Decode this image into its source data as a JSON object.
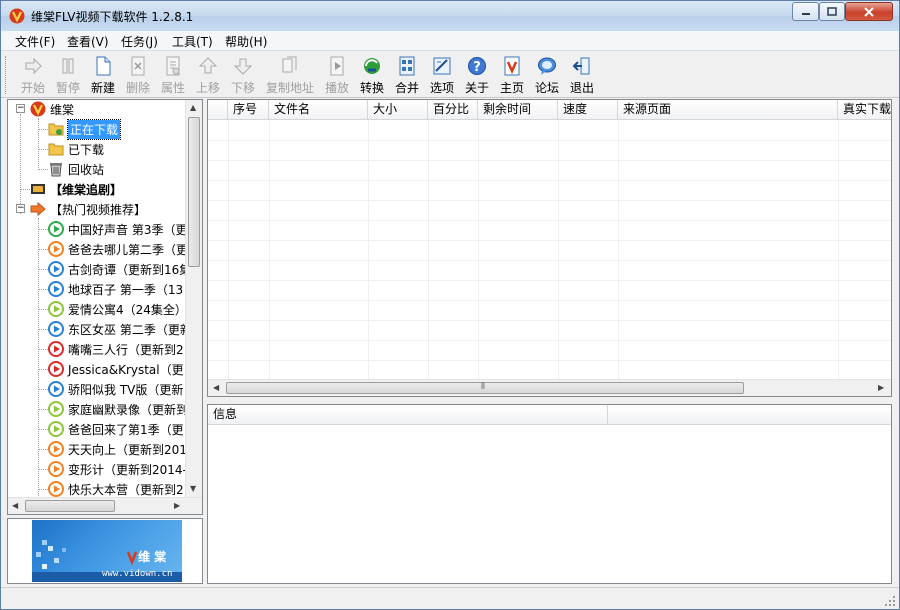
{
  "window": {
    "title": "维棠FLV视频下载软件 1.2.8.1"
  },
  "menu": [
    {
      "label": "文件(F)"
    },
    {
      "label": "查看(V)"
    },
    {
      "label": "任务(J)"
    },
    {
      "label": "工具(T)"
    },
    {
      "label": "帮助(H)"
    }
  ],
  "toolbar": [
    {
      "label": "开始",
      "icon": "start-arrow-icon",
      "enabled": false
    },
    {
      "label": "暂停",
      "icon": "pause-icon",
      "enabled": false
    },
    {
      "label": "新建",
      "icon": "new-document-icon",
      "enabled": true
    },
    {
      "label": "删除",
      "icon": "delete-icon",
      "enabled": false
    },
    {
      "label": "属性",
      "icon": "properties-icon",
      "enabled": false
    },
    {
      "label": "上移",
      "icon": "move-up-icon",
      "enabled": false
    },
    {
      "label": "下移",
      "icon": "move-down-icon",
      "enabled": false
    },
    {
      "label": "复制地址",
      "icon": "copy-address-icon",
      "enabled": false
    },
    {
      "label": "播放",
      "icon": "play-icon",
      "enabled": false
    },
    {
      "label": "转换",
      "icon": "convert-icon",
      "enabled": true
    },
    {
      "label": "合并",
      "icon": "merge-icon",
      "enabled": true
    },
    {
      "label": "选项",
      "icon": "options-icon",
      "enabled": true
    },
    {
      "label": "关于",
      "icon": "about-icon",
      "enabled": true
    },
    {
      "label": "主页",
      "icon": "homepage-icon",
      "enabled": true
    },
    {
      "label": "论坛",
      "icon": "forum-icon",
      "enabled": true
    },
    {
      "label": "退出",
      "icon": "exit-icon",
      "enabled": true
    }
  ],
  "tree": {
    "root": {
      "label": "维棠"
    },
    "children": [
      {
        "label": "正在下载",
        "selected": true
      },
      {
        "label": "已下载"
      },
      {
        "label": "回收站"
      }
    ],
    "drama": {
      "label": "【维棠追剧】"
    },
    "hot": {
      "label": "【热门视频推荐】"
    },
    "hot_items": [
      {
        "label": "中国好声音 第3季（更",
        "icon": "video-site-icon-green"
      },
      {
        "label": "爸爸去哪儿第二季（更",
        "icon": "video-site-icon-orange"
      },
      {
        "label": "古剑奇谭（更新到16集",
        "icon": "video-site-icon-blue"
      },
      {
        "label": "地球百子 第一季（13",
        "icon": "video-site-icon-blue"
      },
      {
        "label": "爱情公寓4（24集全）",
        "icon": "video-site-icon-qiyi"
      },
      {
        "label": "东区女巫 第二季（更新",
        "icon": "video-site-icon-blue"
      },
      {
        "label": "嘴嘴三人行（更新到2",
        "icon": "video-site-icon-red"
      },
      {
        "label": "Jessica&Krystal（更",
        "icon": "video-site-icon-red"
      },
      {
        "label": "骄阳似我 TV版（更新",
        "icon": "video-site-icon-blue"
      },
      {
        "label": "家庭幽默录像（更新到",
        "icon": "video-site-icon-qiyi"
      },
      {
        "label": "爸爸回来了第1季（更",
        "icon": "video-site-icon-qiyi"
      },
      {
        "label": "天天向上（更新到201",
        "icon": "video-site-icon-orange"
      },
      {
        "label": "变形计（更新到2014-",
        "icon": "video-site-icon-orange"
      },
      {
        "label": "快乐大本营（更新到2",
        "icon": "video-site-icon-orange"
      }
    ]
  },
  "banner": {
    "brand": "维 棠",
    "url": "www.vidown.cn"
  },
  "list": {
    "columns": [
      "序号",
      "文件名",
      "大小",
      "百分比",
      "剩余时间",
      "速度",
      "来源页面",
      "真实下载"
    ]
  },
  "info": {
    "header": "信息"
  }
}
